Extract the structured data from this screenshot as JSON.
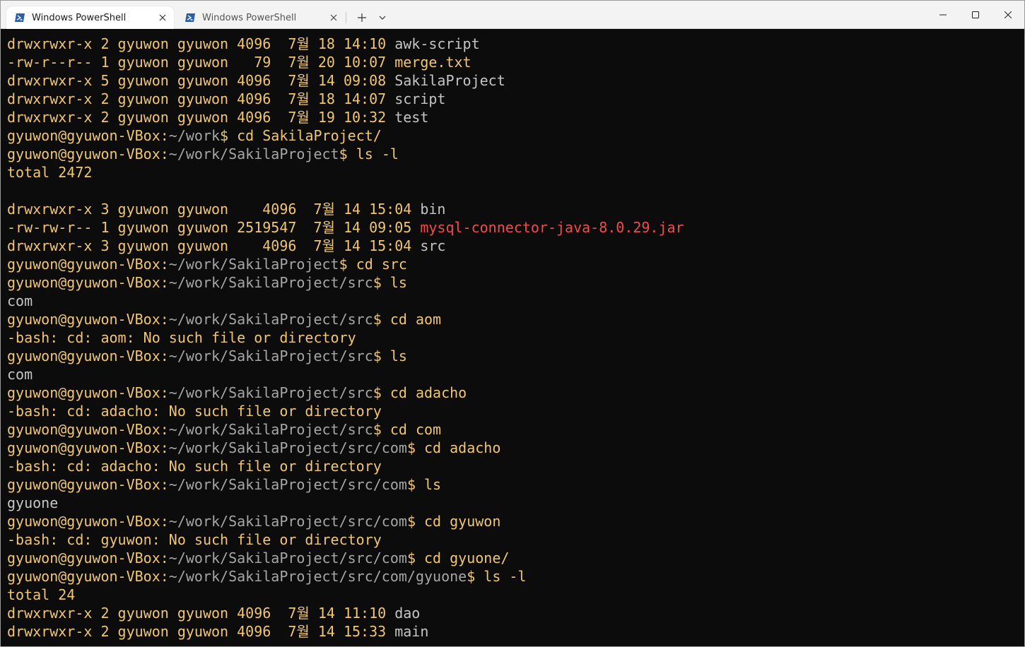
{
  "tabs": [
    {
      "label": "Windows PowerShell"
    },
    {
      "label": "Windows PowerShell"
    }
  ],
  "colors": {
    "background": "#0c0c0c",
    "yellow_text": "#f0c674",
    "name_text": "#c5c5c5",
    "prompt_text": "#a6a6a6",
    "red_text": "#f14c4c",
    "titlebar": "#f3f3f3"
  },
  "icons": {
    "tab_icon": "powershell-icon",
    "tab_close": "close-icon",
    "new_tab": "plus-icon",
    "dropdown": "chevron-down-icon",
    "minimize": "minimize-icon",
    "maximize": "maximize-icon",
    "close": "close-icon"
  },
  "terminal": {
    "lines": [
      [
        {
          "t": "drwxrwxr-x 2 gyuwon gyuwon 4096  7월 18 14:10 ",
          "c": "y"
        },
        {
          "t": "awk-script",
          "c": "g"
        }
      ],
      [
        {
          "t": "-rw-r--r-- 1 gyuwon gyuwon   79  7월 20 10:07 merge.txt",
          "c": "y"
        }
      ],
      [
        {
          "t": "drwxrwxr-x 5 gyuwon gyuwon 4096  7월 14 09:08 ",
          "c": "y"
        },
        {
          "t": "SakilaProject",
          "c": "g"
        }
      ],
      [
        {
          "t": "drwxrwxr-x 2 gyuwon gyuwon 4096  7월 18 14:07 ",
          "c": "y"
        },
        {
          "t": "script",
          "c": "g"
        }
      ],
      [
        {
          "t": "drwxrwxr-x 2 gyuwon gyuwon 4096  7월 19 10:32 ",
          "c": "y"
        },
        {
          "t": "test",
          "c": "g"
        }
      ],
      [
        {
          "t": "gyuwon@gyuwon-VBox:",
          "c": "y"
        },
        {
          "t": "~/work",
          "c": "d"
        },
        {
          "t": "$ cd SakilaProject/",
          "c": "y"
        }
      ],
      [
        {
          "t": "gyuwon@gyuwon-VBox:",
          "c": "y"
        },
        {
          "t": "~/work/SakilaProject",
          "c": "d"
        },
        {
          "t": "$ ls -l",
          "c": "y"
        }
      ],
      [
        {
          "t": "total 2472",
          "c": "y"
        }
      ],
      [
        {
          "t": "",
          "c": "y"
        }
      ],
      [
        {
          "t": "drwxrwxr-x 3 gyuwon gyuwon    4096  7월 14 15:04 ",
          "c": "y"
        },
        {
          "t": "bin",
          "c": "g"
        }
      ],
      [
        {
          "t": "-rw-rw-r-- 1 gyuwon gyuwon 2519547  7월 14 09:05 ",
          "c": "y"
        },
        {
          "t": "mysql-connector-java-8.0.29.jar",
          "c": "r"
        }
      ],
      [
        {
          "t": "drwxrwxr-x 3 gyuwon gyuwon    4096  7월 14 15:04 ",
          "c": "y"
        },
        {
          "t": "src",
          "c": "g"
        }
      ],
      [
        {
          "t": "gyuwon@gyuwon-VBox:",
          "c": "y"
        },
        {
          "t": "~/work/SakilaProject",
          "c": "d"
        },
        {
          "t": "$ cd src",
          "c": "y"
        }
      ],
      [
        {
          "t": "gyuwon@gyuwon-VBox:",
          "c": "y"
        },
        {
          "t": "~/work/SakilaProject/src",
          "c": "d"
        },
        {
          "t": "$ ls",
          "c": "y"
        }
      ],
      [
        {
          "t": "com",
          "c": "g"
        }
      ],
      [
        {
          "t": "gyuwon@gyuwon-VBox:",
          "c": "y"
        },
        {
          "t": "~/work/SakilaProject/src",
          "c": "d"
        },
        {
          "t": "$ cd aom",
          "c": "y"
        }
      ],
      [
        {
          "t": "-bash: cd: aom: No such file or directory",
          "c": "y"
        }
      ],
      [
        {
          "t": "gyuwon@gyuwon-VBox:",
          "c": "y"
        },
        {
          "t": "~/work/SakilaProject/src",
          "c": "d"
        },
        {
          "t": "$ ls",
          "c": "y"
        }
      ],
      [
        {
          "t": "com",
          "c": "g"
        }
      ],
      [
        {
          "t": "gyuwon@gyuwon-VBox:",
          "c": "y"
        },
        {
          "t": "~/work/SakilaProject/src",
          "c": "d"
        },
        {
          "t": "$ cd adacho",
          "c": "y"
        }
      ],
      [
        {
          "t": "-bash: cd: adacho: No such file or directory",
          "c": "y"
        }
      ],
      [
        {
          "t": "gyuwon@gyuwon-VBox:",
          "c": "y"
        },
        {
          "t": "~/work/SakilaProject/src",
          "c": "d"
        },
        {
          "t": "$ cd com",
          "c": "y"
        }
      ],
      [
        {
          "t": "gyuwon@gyuwon-VBox:",
          "c": "y"
        },
        {
          "t": "~/work/SakilaProject/src/com",
          "c": "d"
        },
        {
          "t": "$ cd adacho",
          "c": "y"
        }
      ],
      [
        {
          "t": "-bash: cd: adacho: No such file or directory",
          "c": "y"
        }
      ],
      [
        {
          "t": "gyuwon@gyuwon-VBox:",
          "c": "y"
        },
        {
          "t": "~/work/SakilaProject/src/com",
          "c": "d"
        },
        {
          "t": "$ ls",
          "c": "y"
        }
      ],
      [
        {
          "t": "gyuone",
          "c": "g"
        }
      ],
      [
        {
          "t": "gyuwon@gyuwon-VBox:",
          "c": "y"
        },
        {
          "t": "~/work/SakilaProject/src/com",
          "c": "d"
        },
        {
          "t": "$ cd gyuwon",
          "c": "y"
        }
      ],
      [
        {
          "t": "-bash: cd: gyuwon: No such file or directory",
          "c": "y"
        }
      ],
      [
        {
          "t": "gyuwon@gyuwon-VBox:",
          "c": "y"
        },
        {
          "t": "~/work/SakilaProject/src/com",
          "c": "d"
        },
        {
          "t": "$ cd gyuone/",
          "c": "y"
        }
      ],
      [
        {
          "t": "gyuwon@gyuwon-VBox:",
          "c": "y"
        },
        {
          "t": "~/work/SakilaProject/src/com/gyuone",
          "c": "d"
        },
        {
          "t": "$ ls -l",
          "c": "y"
        }
      ],
      [
        {
          "t": "total 24",
          "c": "y"
        }
      ],
      [
        {
          "t": "drwxrwxr-x 2 gyuwon gyuwon 4096  7월 14 11:10 ",
          "c": "y"
        },
        {
          "t": "dao",
          "c": "g"
        }
      ],
      [
        {
          "t": "drwxrwxr-x 2 gyuwon gyuwon 4096  7월 14 15:33 ",
          "c": "y"
        },
        {
          "t": "main",
          "c": "g"
        }
      ]
    ]
  }
}
